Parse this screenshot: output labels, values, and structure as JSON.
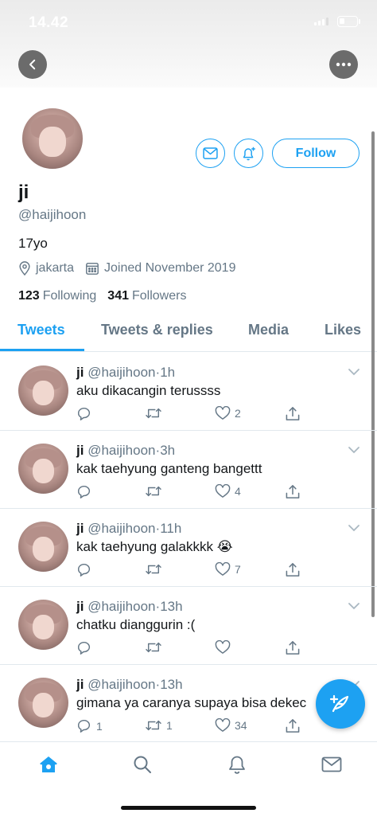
{
  "status_bar": {
    "time": "14.42"
  },
  "profile": {
    "display_name": "ji",
    "handle": "@haijihoon",
    "bio": "17yo",
    "location": "jakarta",
    "joined": "Joined November 2019",
    "following_count": "123",
    "following_label": "Following",
    "followers_count": "341",
    "followers_label": "Followers",
    "follow_label": "Follow"
  },
  "tabs": [
    {
      "label": "Tweets",
      "active": true
    },
    {
      "label": "Tweets & replies",
      "active": false
    },
    {
      "label": "Media",
      "active": false
    },
    {
      "label": "Likes",
      "active": false
    }
  ],
  "tweets": [
    {
      "name": "ji",
      "handle": "@haijihoon",
      "time": "1h",
      "text": "aku dikacangin terussss",
      "replies": "",
      "retweets": "",
      "likes": "2"
    },
    {
      "name": "ji",
      "handle": "@haijihoon",
      "time": "3h",
      "text": "kak taehyung ganteng bangettt",
      "replies": "",
      "retweets": "",
      "likes": "4"
    },
    {
      "name": "ji",
      "handle": "@haijihoon",
      "time": "11h",
      "text": "kak taehyung galakkkk 😭",
      "replies": "",
      "retweets": "",
      "likes": "7"
    },
    {
      "name": "ji",
      "handle": "@haijihoon",
      "time": "13h",
      "text": "chatku dianggurin :(",
      "replies": "",
      "retweets": "",
      "likes": ""
    },
    {
      "name": "ji",
      "handle": "@haijihoon",
      "time": "13h",
      "text": "gimana ya caranya supaya bisa dekec",
      "replies": "1",
      "retweets": "1",
      "likes": "34"
    }
  ],
  "colors": {
    "accent": "#1da1f2",
    "muted": "#657786",
    "text": "#14171a"
  },
  "icons": {
    "back": "arrow-left-icon",
    "more": "more-icon",
    "message": "mail-icon",
    "notify": "bell-plus-icon",
    "location": "location-pin-icon",
    "calendar": "calendar-icon",
    "compose": "compose-feather-icon",
    "nav": [
      "home-icon",
      "search-icon",
      "bell-icon",
      "mail-icon"
    ]
  }
}
